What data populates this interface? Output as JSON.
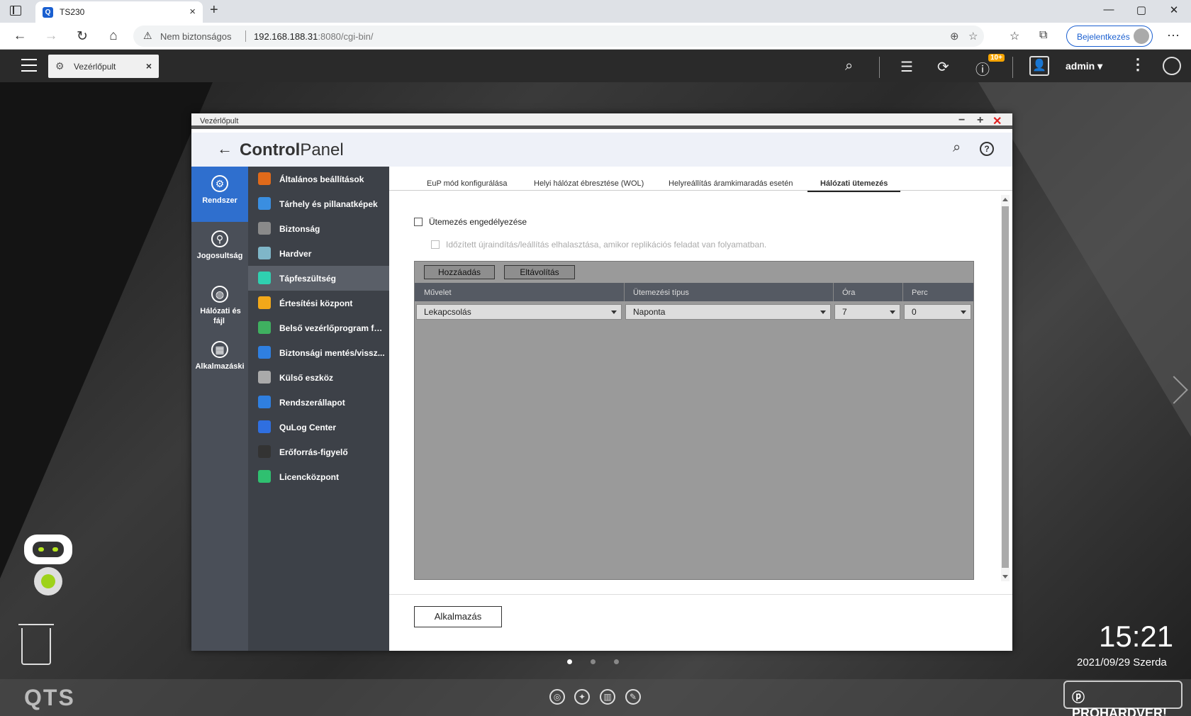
{
  "browser": {
    "tab_title": "TS230",
    "tab_close": "×",
    "new_tab": "+",
    "security_label": "Nem biztonságos",
    "url_host": "192.168.188.31",
    "url_rest": ":8080/cgi-bin/",
    "signin_label": "Bejelentkezés",
    "win_min": "—",
    "win_max": "▢",
    "win_close": "✕"
  },
  "qts": {
    "tab_label": "Vezérlőpult",
    "tab_close": "×",
    "notification_badge": "10+",
    "username": "admin ▾"
  },
  "window": {
    "title": "Vezérlőpult",
    "header_bold": "Control",
    "header_light": "Panel",
    "help": "?"
  },
  "categories": [
    {
      "label": "Rendszer",
      "icon": "⚙"
    },
    {
      "label": "Jogosultság",
      "icon": "👤"
    },
    {
      "label": "Hálózati és fájl",
      "icon": "🌐"
    },
    {
      "label": "Alkalmazáski",
      "icon": "▦"
    }
  ],
  "menu": [
    {
      "label": "Általános beállítások",
      "color": "#e06a1a"
    },
    {
      "label": "Tárhely és pillanatképek",
      "color": "#3a8ee0"
    },
    {
      "label": "Biztonság",
      "color": "#8a8a8a"
    },
    {
      "label": "Hardver",
      "color": "#7fb6c8"
    },
    {
      "label": "Tápfeszültség",
      "color": "#2fd0b0"
    },
    {
      "label": "Értesítési központ",
      "color": "#f2a81a"
    },
    {
      "label": "Belső vezérlőprogram fri...",
      "color": "#3fb060"
    },
    {
      "label": "Biztonsági mentés/vissz...",
      "color": "#2f7fe0"
    },
    {
      "label": "Külső eszköz",
      "color": "#aaaaaa"
    },
    {
      "label": "Rendszerállapot",
      "color": "#2f7fe0"
    },
    {
      "label": "QuLog Center",
      "color": "#2f6fe0"
    },
    {
      "label": "Erőforrás-figyelő",
      "color": "#333333"
    },
    {
      "label": "Licencközpont",
      "color": "#2fc070"
    }
  ],
  "tabs": [
    {
      "label": "EuP mód konfigurálása"
    },
    {
      "label": "Helyi hálózat ébresztése (WOL)"
    },
    {
      "label": "Helyreállítás áramkimaradás esetén"
    },
    {
      "label": "Hálózati ütemezés"
    }
  ],
  "schedule": {
    "enable_label": "Ütemezés engedélyezése",
    "delay_label": "Időzített újraindítás/leállítás elhalasztása, amikor replikációs feladat van folyamatban.",
    "add_button": "Hozzáadás",
    "remove_button": "Eltávolítás",
    "columns": [
      "Művelet",
      "Ütemezési típus",
      "Óra",
      "Perc"
    ],
    "row": {
      "action": "Lekapcsolás",
      "type": "Naponta",
      "hour": "7",
      "minute": "0"
    },
    "apply_button": "Alkalmazás"
  },
  "desktop": {
    "time": "15:21",
    "date": "2021/09/29 Szerda",
    "logo": "QTS",
    "watermark": "ⓟ PROHARDVER!"
  }
}
